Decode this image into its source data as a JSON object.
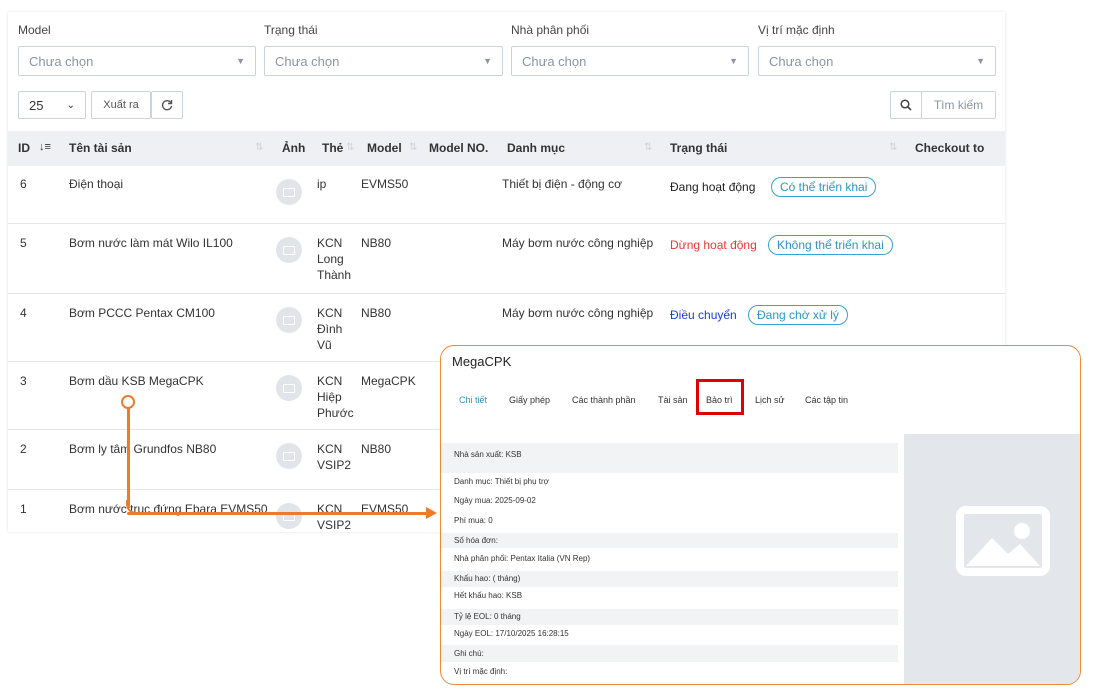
{
  "filters": [
    {
      "label": "Model",
      "placeholder": "Chưa chọn"
    },
    {
      "label": "Trạng thái",
      "placeholder": "Chưa chọn"
    },
    {
      "label": "Nhà phân phối",
      "placeholder": "Chưa chọn"
    },
    {
      "label": "Vị trí mặc định",
      "placeholder": "Chưa chọn"
    }
  ],
  "toolbar": {
    "page_size": "25",
    "export_label": "Xuất ra",
    "search_placeholder": "Tìm kiếm"
  },
  "columns": {
    "id": "ID",
    "name": "Tên tài sản",
    "image": "Ảnh",
    "tag": "Thẻ",
    "model": "Model",
    "model_no": "Model NO.",
    "category": "Danh mục",
    "status": "Trạng thái",
    "checkout": "Checkout to"
  },
  "rows": [
    {
      "id": "6",
      "name": "Điện thoại",
      "tag": "ip",
      "model": "EVMS50",
      "category": "Thiết bị điện - động cơ",
      "status": "Đang hoạt động",
      "badge": "Có thể triển khai"
    },
    {
      "id": "5",
      "name": "Bơm nước làm mát Wilo IL100",
      "tag": "KCN\nLong\nThành",
      "model": "NB80",
      "category": "Máy bơm nước công nghiệp",
      "status": "Dừng hoạt động",
      "badge": "Không thể triển khai"
    },
    {
      "id": "4",
      "name": "Bơm PCCC Pentax CM100",
      "tag": "KCN\nĐình\nVũ",
      "model": "NB80",
      "category": "Máy bơm nước công nghiệp",
      "status": "Điều chuyển",
      "badge": "Đang chờ xử lý"
    },
    {
      "id": "3",
      "name": "Bơm dầu KSB MegaCPK",
      "tag": "KCN\nHiệp\nPhước",
      "model": "MegaCPK",
      "category": "",
      "status": "",
      "badge": ""
    },
    {
      "id": "2",
      "name": "Bơm ly tâm Grundfos NB80",
      "tag": "KCN\nVSIP2",
      "model": "NB80",
      "category": "",
      "status": "",
      "badge": ""
    },
    {
      "id": "1",
      "name": "Bơm nước trục đứng Ebara EVMS50",
      "tag": "KCN\nVSIP2",
      "model": "EVMS50",
      "category": "",
      "status": "",
      "badge": ""
    }
  ],
  "status_colors": {
    "active": "#222222",
    "stopped": "#e53935",
    "transfer": "#1a3fd6",
    "accent": "#ea8a3a"
  },
  "modal": {
    "title": "MegaCPK",
    "tabs": [
      "Chi tiết",
      "Giấy phép",
      "Các thành phần",
      "Tài sản",
      "Bảo trì",
      "Lịch sử",
      "Các tập tin"
    ],
    "fields": [
      "Nhà sản xuất: KSB",
      "Danh mục: Thiết bị phụ trợ",
      "Ngày mua: 2025-09-02",
      "Phí mua: 0",
      "Số hóa đơn:",
      "Nhà phân phối: Pentax Italia (VN Rep)",
      "Khấu hao: ( tháng)",
      "Hết khấu hao: KSB",
      "Tỷ lệ EOL: 0 tháng",
      "Ngày EOL: 17/10/2025 16:28:15",
      "Ghi chú:",
      "Vị trí mặc định:"
    ]
  }
}
